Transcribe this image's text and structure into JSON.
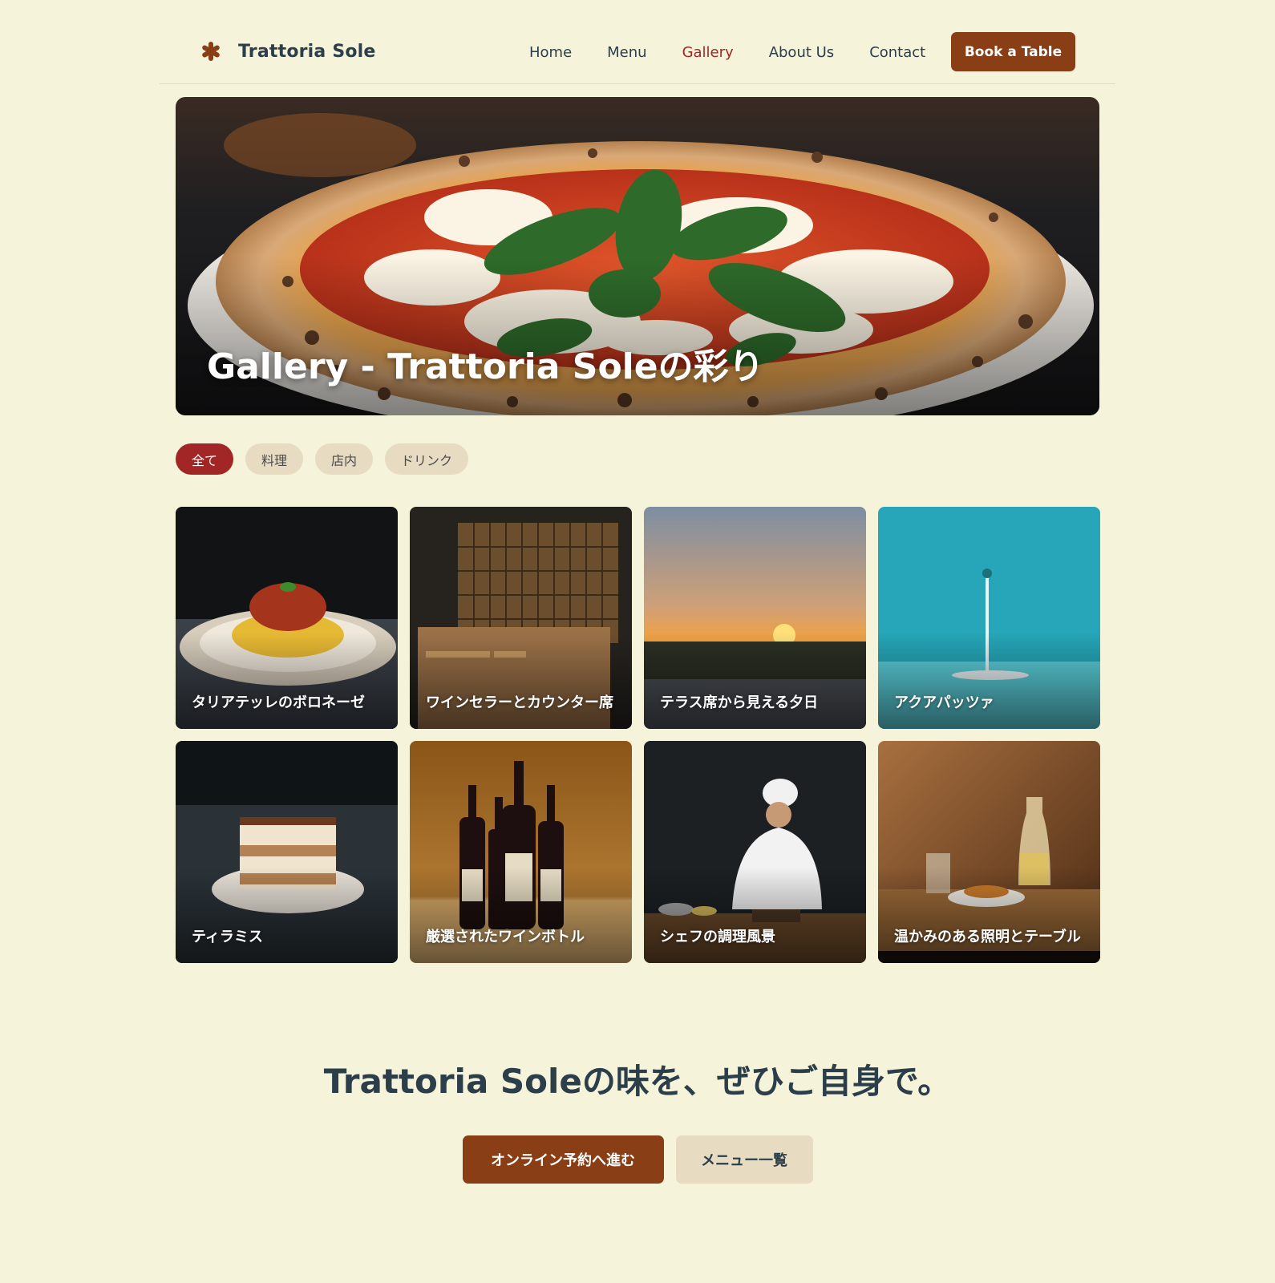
{
  "brand": {
    "name": "Trattoria Sole",
    "icon": "asterisk-icon",
    "color": "#8a3e15"
  },
  "nav": {
    "items": [
      {
        "label": "Home"
      },
      {
        "label": "Menu"
      },
      {
        "label": "Gallery",
        "active": true
      },
      {
        "label": "About Us"
      },
      {
        "label": "Contact"
      }
    ],
    "cta": "Book a Table"
  },
  "hero": {
    "title": "Gallery - Trattoria Soleの彩り"
  },
  "filters": [
    {
      "label": "全て",
      "active": true
    },
    {
      "label": "料理"
    },
    {
      "label": "店内"
    },
    {
      "label": "ドリンク"
    }
  ],
  "gallery": [
    {
      "caption": "タリアテッレのボロネーゼ"
    },
    {
      "caption": "ワインセラーとカウンター席"
    },
    {
      "caption": "テラス席から見える夕日"
    },
    {
      "caption": "アクアパッツァ"
    },
    {
      "caption": "ティラミス"
    },
    {
      "caption": "厳選されたワインボトル"
    },
    {
      "caption": "シェフの調理風景"
    },
    {
      "caption": "温かみのある照明とテーブル"
    }
  ],
  "cta": {
    "title": "Trattoria Soleの味を、ぜひご自身で。",
    "primary": "オンライン予約へ進む",
    "secondary": "メニュー一覧"
  },
  "colors": {
    "background": "#f5f3da",
    "accent_brown": "#8a3e15",
    "accent_red": "#a22626",
    "chip_bg": "#e7dcc2",
    "text": "#2c3e4a"
  }
}
